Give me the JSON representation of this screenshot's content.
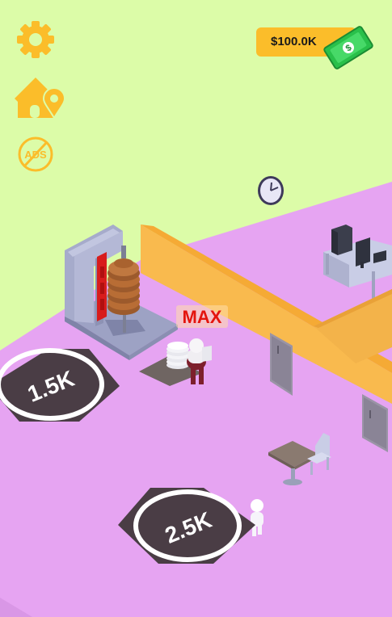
{
  "hud": {
    "money": "$100.0K",
    "ads_label": "ADS",
    "settings_icon": "gear-icon",
    "home_icon": "home-location-icon",
    "ads_icon": "ads-off-icon",
    "cash_icon": "dollar-bill-icon"
  },
  "shawarma_station": {
    "level_label": "MAX"
  },
  "purchase_pads": [
    {
      "price": "1.5K"
    },
    {
      "price": "2.5K"
    }
  ],
  "colors": {
    "background": "#dcfca8",
    "floor": "#e6a4f2",
    "wall": "#f9ba4e",
    "hud_accent": "#fbbd2a",
    "max_text": "#e4140e",
    "pad": "#4a3d45"
  }
}
